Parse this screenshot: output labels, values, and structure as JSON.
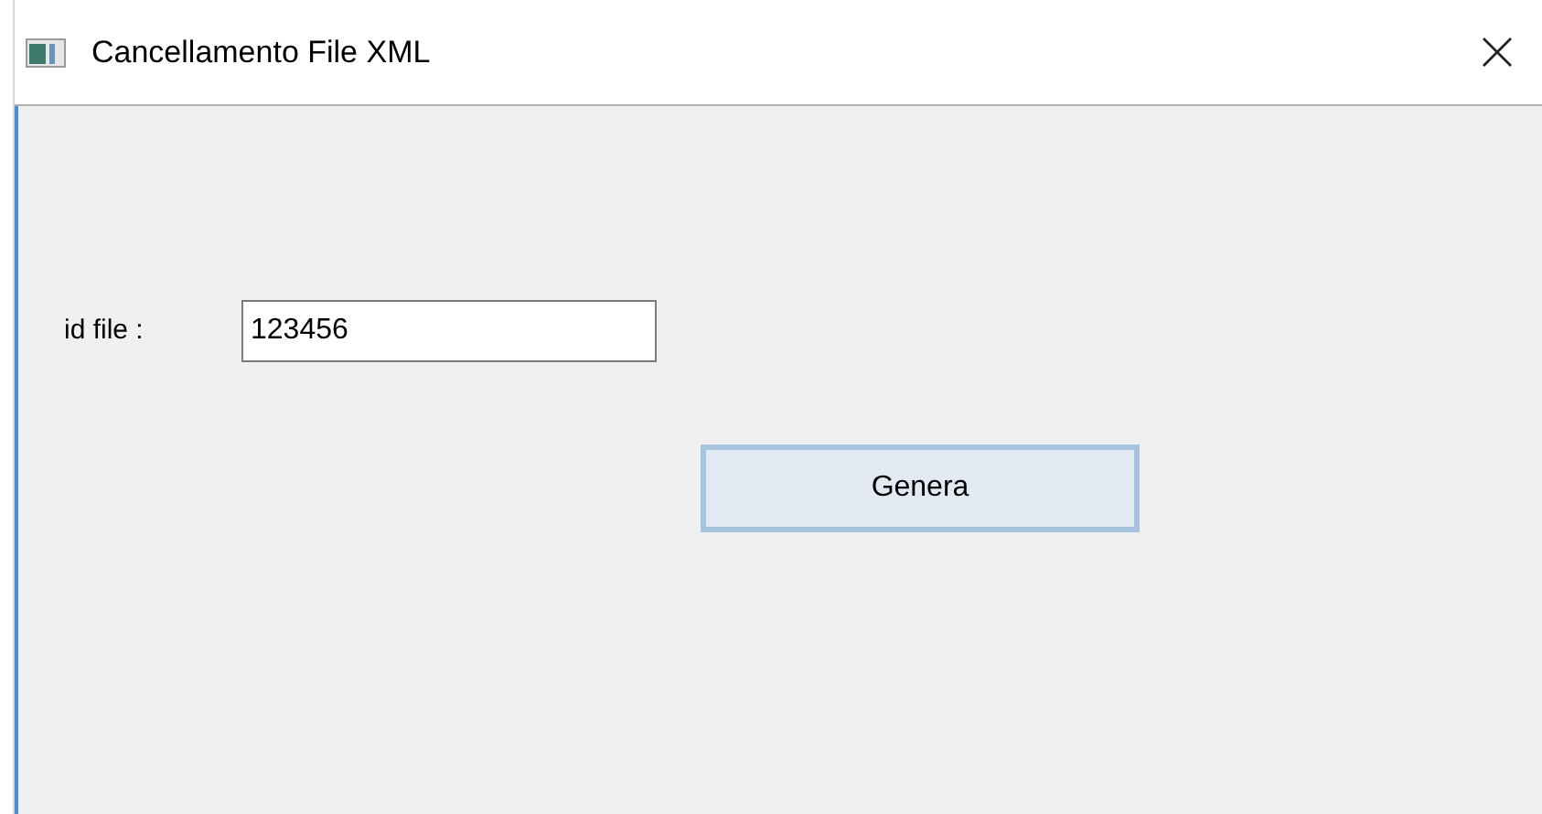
{
  "window": {
    "title": "Cancellamento File XML"
  },
  "form": {
    "label": "id file :",
    "value": "123456"
  },
  "buttons": [
    {
      "label": "Genera",
      "focused": true
    }
  ]
}
